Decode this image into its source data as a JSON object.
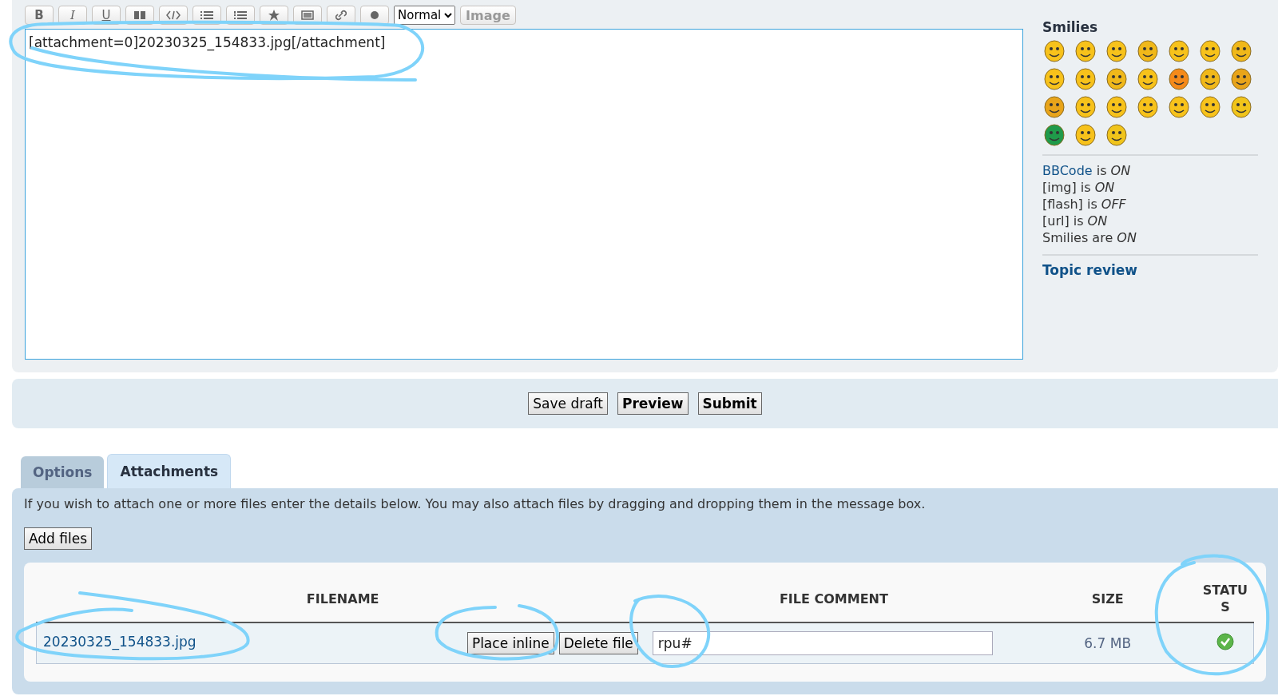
{
  "toolbar": {
    "buttons": [
      {
        "kind": "bold",
        "label": "B"
      },
      {
        "kind": "italic",
        "label": "I"
      },
      {
        "kind": "underline",
        "label": "U"
      },
      {
        "kind": "quote"
      },
      {
        "kind": "code"
      },
      {
        "kind": "list"
      },
      {
        "kind": "olist"
      },
      {
        "kind": "star"
      },
      {
        "kind": "image"
      },
      {
        "kind": "link"
      },
      {
        "kind": "color"
      }
    ],
    "font_size": "Normal",
    "image_button": "Image"
  },
  "editor": {
    "value": "[attachment=0]20230325_154833.jpg[/attachment]"
  },
  "sidebar": {
    "smilies_title": "Smilies",
    "settings": [
      {
        "link": "BBCode",
        "text": " is *ON*"
      },
      {
        "text": "[img] is *ON*"
      },
      {
        "text": "[flash] is *OFF*"
      },
      {
        "text": "[url] is *ON*"
      },
      {
        "text": "Smilies are *ON*"
      }
    ],
    "topic_review": "Topic review"
  },
  "buttons": [
    {
      "label": "Save draft",
      "primary": false
    },
    {
      "label": "Preview",
      "primary": true
    },
    {
      "label": "Submit",
      "primary": true
    }
  ],
  "tabs": [
    {
      "label": "Options",
      "selected": false
    },
    {
      "label": "Attachments",
      "selected": true
    }
  ],
  "attachments": {
    "description": "If you wish to attach one or more files enter the details below. You may also attach files by dragging and dropping them in the message box.",
    "add_button": "Add files",
    "columns": [
      "FILENAME",
      "FILE COMMENT",
      "SIZE",
      "STATUS"
    ],
    "rows": [
      {
        "filename": "20230325_154833.jpg",
        "place_inline": "Place inline",
        "delete": "Delete file",
        "comment": "rpu#",
        "size": "6.7 MB",
        "uploaded": true
      }
    ]
  }
}
